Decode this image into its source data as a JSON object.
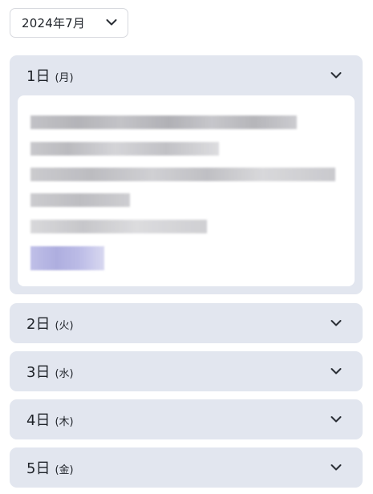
{
  "month_select": {
    "label": "2024年7月"
  },
  "days": [
    {
      "day": "1日",
      "weekday": "(月)",
      "expanded": true
    },
    {
      "day": "2日",
      "weekday": "(火)",
      "expanded": false
    },
    {
      "day": "3日",
      "weekday": "(水)",
      "expanded": false
    },
    {
      "day": "4日",
      "weekday": "(木)",
      "expanded": false
    },
    {
      "day": "5日",
      "weekday": "(金)",
      "expanded": false
    }
  ],
  "icons": {
    "month_dropdown": "chevron-down-icon",
    "day_toggle": "chevron-down-icon"
  },
  "colors": {
    "card_background": "#e2e6ef",
    "content_background": "#ffffff",
    "blurred_link": "#a6a6dc"
  }
}
